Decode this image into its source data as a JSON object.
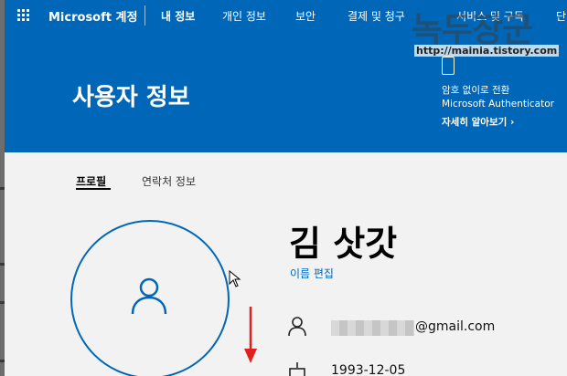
{
  "header": {
    "brand": "Microsoft 계정",
    "nav": [
      "내 정보",
      "개인 정보",
      "보안",
      "결제 및 청구",
      "서비스 및 구독",
      "단"
    ]
  },
  "page": {
    "title": "사용자 정보"
  },
  "promo": {
    "line1": "암호 없이로 전환",
    "line2": "Microsoft Authenticator",
    "link": "자세히 알아보기"
  },
  "watermark": {
    "title": "녹두장군",
    "url": "http://mainia.tistory.com"
  },
  "tabs": [
    {
      "label": "프로필",
      "active": true
    },
    {
      "label": "연락처 정보",
      "active": false
    }
  ],
  "profile": {
    "name": "김 삿갓",
    "edit_name_label": "이름 편집",
    "email_suffix": "@gmail.com",
    "dob": "1993-12-05"
  },
  "icons": {
    "waffle": "waffle-icon",
    "avatar": "person-icon",
    "email": "person-icon",
    "dob": "cake-icon",
    "promo": "phone-key-icon",
    "arrow": "red-down-arrow"
  },
  "colors": {
    "brand": "#0067b8",
    "background": "#f2f2f2",
    "annotation": "#e02020"
  }
}
